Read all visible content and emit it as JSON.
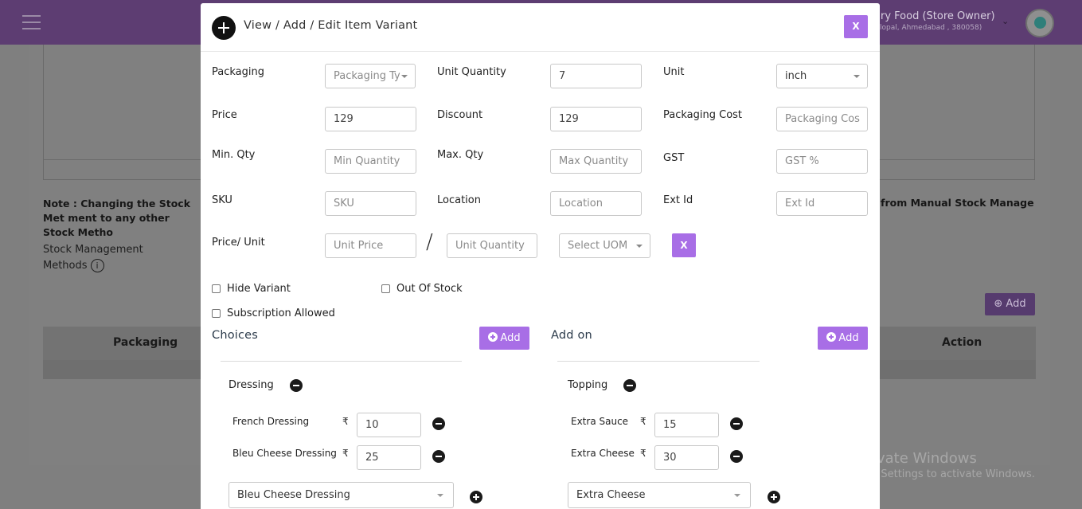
{
  "background": {
    "store_name": "ry Food (Store Owner)",
    "store_address": "lopal, Ahmedabad , 380058)",
    "note_left": "Note : Changing the Stock Met ment to any other Stock Metho",
    "note_right": "from Manual Stock Manage",
    "stock_label_line1": "Stock Management",
    "stock_label_line2": "Methods",
    "info_glyph": "i",
    "add_label": "Add",
    "table_headers": [
      "Packaging",
      "Action"
    ]
  },
  "modal": {
    "title": "View / Add / Edit Item Variant",
    "close_label": "X",
    "fields": {
      "packaging": {
        "label": "Packaging",
        "placeholder": "Packaging Ty"
      },
      "unit_quantity": {
        "label": "Unit Quantity",
        "value": "7"
      },
      "unit": {
        "label": "Unit",
        "value": "inch"
      },
      "price": {
        "label": "Price",
        "value": "129"
      },
      "discount": {
        "label": "Discount",
        "value": "129"
      },
      "packaging_cost": {
        "label": "Packaging Cost",
        "placeholder": "Packaging Cos"
      },
      "min_qty": {
        "label": "Min. Qty",
        "placeholder": "Min Quantity"
      },
      "max_qty": {
        "label": "Max. Qty",
        "placeholder": "Max Quantity"
      },
      "gst": {
        "label": "GST",
        "placeholder": "GST %"
      },
      "sku": {
        "label": "SKU",
        "placeholder": "SKU"
      },
      "location": {
        "label": "Location",
        "placeholder": "Location"
      },
      "ext_id": {
        "label": "Ext Id",
        "placeholder": "Ext Id"
      },
      "price_unit": {
        "label": "Price/ Unit",
        "unit_price_placeholder": "Unit Price",
        "unit_quantity_placeholder": "Unit Quantity",
        "separator": "/",
        "uom_placeholder": "Select UOM",
        "clear_label": "X"
      }
    },
    "checkboxes": {
      "hide_variant": {
        "label": "Hide Variant",
        "checked": false
      },
      "out_of_stock": {
        "label": "Out Of Stock",
        "checked": false
      },
      "subscription_allowed": {
        "label": "Subscription Allowed",
        "checked": false
      }
    },
    "choices": {
      "title": "Choices",
      "add_label": "Add",
      "group_name": "Dressing",
      "currency": "₹",
      "options": [
        {
          "name": "French Dressing",
          "price": "10"
        },
        {
          "name": "Bleu Cheese Dressing",
          "price": "25"
        }
      ],
      "selected": "Bleu Cheese Dressing"
    },
    "addons": {
      "title": "Add on",
      "add_label": "Add",
      "group_name": "Topping",
      "currency": "₹",
      "options": [
        {
          "name": "Extra Sauce",
          "price": "15"
        },
        {
          "name": "Extra Cheese",
          "price": "30"
        }
      ],
      "selected": "Extra Cheese"
    }
  },
  "watermark": {
    "line1": "Activate Windows",
    "line2": "Go to Settings to activate Windows."
  },
  "colors": {
    "accent": "#a86ee6",
    "topbar": "#5d3d72"
  }
}
